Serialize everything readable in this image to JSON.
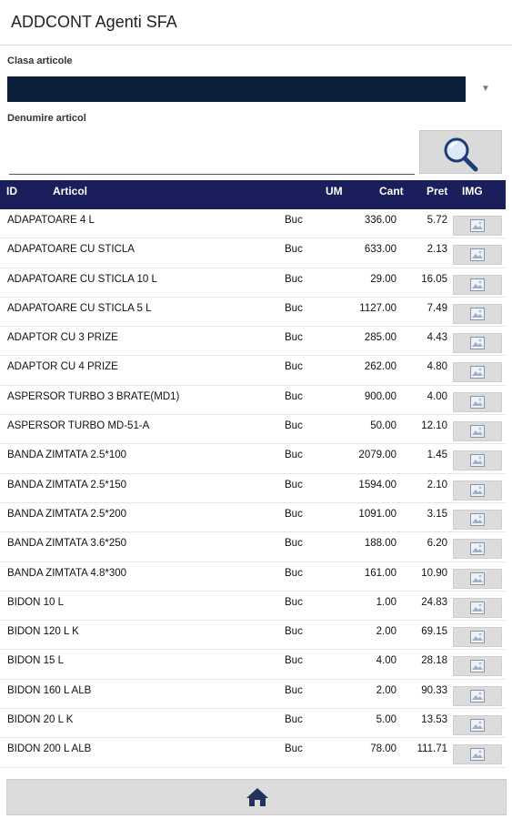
{
  "app": {
    "title": "ADDCONT Agenti SFA"
  },
  "filters": {
    "class_label": "Clasa articole",
    "class_value": "",
    "name_label": "Denumire articol",
    "name_value": ""
  },
  "icons": {
    "search": "search-icon",
    "image": "image-icon",
    "home": "home-icon",
    "dropdown": "chevron-down-icon"
  },
  "colors": {
    "header_bg": "#1a1e5a",
    "select_bg": "#0b1e3a",
    "home_icon": "#23335e"
  },
  "table": {
    "headers": {
      "id": "ID",
      "articol": "Articol",
      "um": "UM",
      "cant": "Cant",
      "pret": "Pret",
      "img": "IMG"
    },
    "rows": [
      {
        "name": "ADAPATOARE 4 L",
        "um": "Buc",
        "cant": "336.00",
        "pret": "5.72"
      },
      {
        "name": "ADAPATOARE CU STICLA",
        "um": "Buc",
        "cant": "633.00",
        "pret": "2.13"
      },
      {
        "name": "ADAPATOARE CU STICLA 10 L",
        "um": "Buc",
        "cant": "29.00",
        "pret": "16.05"
      },
      {
        "name": "ADAPATOARE CU STICLA 5 L",
        "um": "Buc",
        "cant": "1127.00",
        "pret": "7.49"
      },
      {
        "name": "ADAPTOR CU 3 PRIZE",
        "um": "Buc",
        "cant": "285.00",
        "pret": "4.43"
      },
      {
        "name": "ADAPTOR CU 4 PRIZE",
        "um": "Buc",
        "cant": "262.00",
        "pret": "4.80"
      },
      {
        "name": "ASPERSOR TURBO 3 BRATE(MD1)",
        "um": "Buc",
        "cant": "900.00",
        "pret": "4.00"
      },
      {
        "name": "ASPERSOR TURBO MD-51-A",
        "um": "Buc",
        "cant": "50.00",
        "pret": "12.10"
      },
      {
        "name": "BANDA ZIMTATA 2.5*100",
        "um": "Buc",
        "cant": "2079.00",
        "pret": "1.45"
      },
      {
        "name": "BANDA ZIMTATA 2.5*150",
        "um": "Buc",
        "cant": "1594.00",
        "pret": "2.10"
      },
      {
        "name": "BANDA ZIMTATA 2.5*200",
        "um": "Buc",
        "cant": "1091.00",
        "pret": "3.15"
      },
      {
        "name": "BANDA ZIMTATA 3.6*250",
        "um": "Buc",
        "cant": "188.00",
        "pret": "6.20"
      },
      {
        "name": "BANDA ZIMTATA 4.8*300",
        "um": "Buc",
        "cant": "161.00",
        "pret": "10.90"
      },
      {
        "name": "BIDON 10 L",
        "um": "Buc",
        "cant": "1.00",
        "pret": "24.83"
      },
      {
        "name": "BIDON 120 L K",
        "um": "Buc",
        "cant": "2.00",
        "pret": "69.15"
      },
      {
        "name": "BIDON 15 L",
        "um": "Buc",
        "cant": "4.00",
        "pret": "28.18"
      },
      {
        "name": "BIDON 160 L ALB",
        "um": "Buc",
        "cant": "2.00",
        "pret": "90.33"
      },
      {
        "name": "BIDON 20 L K",
        "um": "Buc",
        "cant": "5.00",
        "pret": "13.53"
      },
      {
        "name": "BIDON 200 L ALB",
        "um": "Buc",
        "cant": "78.00",
        "pret": "111.71"
      }
    ]
  }
}
